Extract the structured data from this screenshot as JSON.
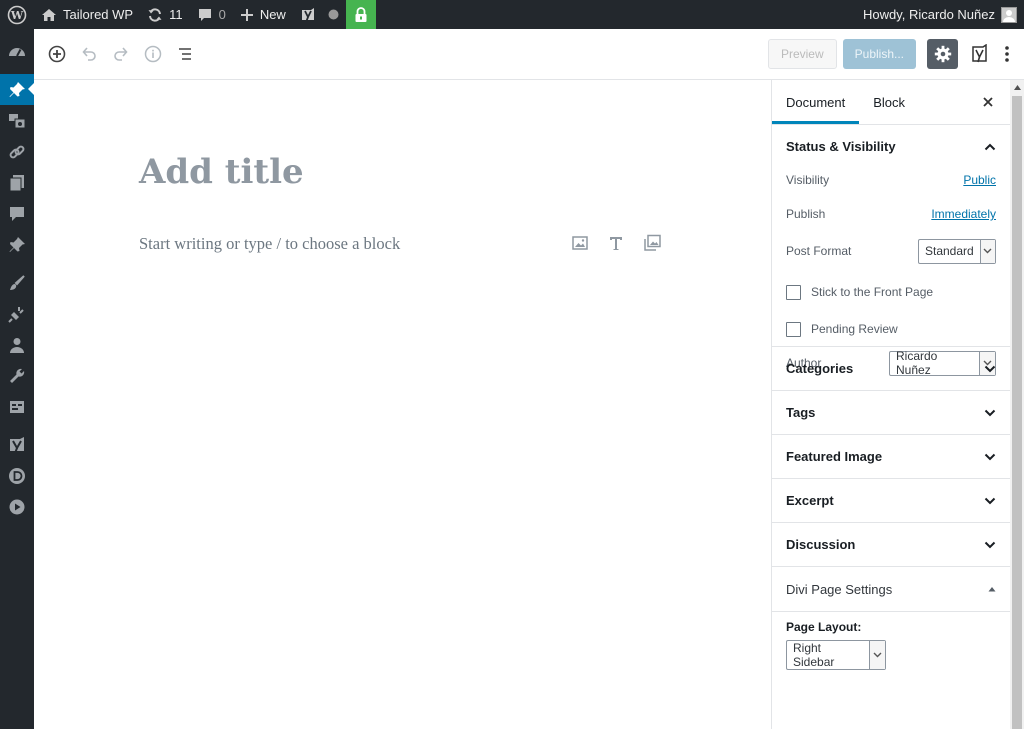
{
  "adminbar": {
    "site_name": "Tailored WP",
    "updates_count": "11",
    "comments_count": "0",
    "new_label": "New",
    "greeting": "Howdy, Ricardo Nuñez"
  },
  "toolbar": {
    "preview_label": "Preview",
    "publish_label": "Publish..."
  },
  "editor": {
    "title_placeholder": "Add title",
    "block_placeholder": "Start writing or type / to choose a block"
  },
  "sidebar": {
    "tabs": [
      {
        "label": "Document"
      },
      {
        "label": "Block"
      }
    ],
    "status": {
      "heading": "Status & Visibility",
      "visibility_label": "Visibility",
      "visibility_value": "Public",
      "publish_label": "Publish",
      "publish_value": "Immediately",
      "post_format_label": "Post Format",
      "post_format_value": "Standard",
      "sticky_label": "Stick to the Front Page",
      "pending_label": "Pending Review",
      "author_label": "Author",
      "author_value": "Ricardo Nuñez"
    },
    "panels": [
      {
        "label": "Categories"
      },
      {
        "label": "Tags"
      },
      {
        "label": "Featured Image"
      },
      {
        "label": "Excerpt"
      },
      {
        "label": "Discussion"
      }
    ],
    "divi": {
      "heading": "Divi Page Settings",
      "layout_label": "Page Layout:",
      "layout_value": "Right Sidebar"
    }
  },
  "colors": {
    "adminbar_bg": "#23282d",
    "active_menu": "#0073aa",
    "lock_green": "#46b450",
    "link_blue": "#0073aa"
  }
}
